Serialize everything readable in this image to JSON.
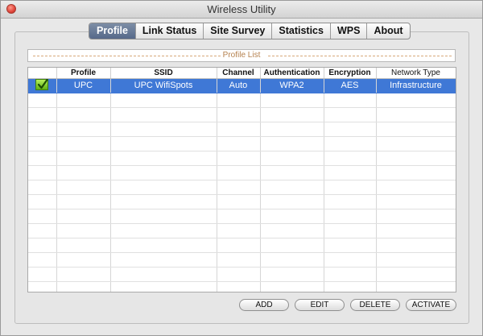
{
  "window": {
    "title": "Wireless Utility"
  },
  "tabs": [
    "Profile",
    "Link Status",
    "Site Survey",
    "Statistics",
    "WPS",
    "About"
  ],
  "active_tab": "Profile",
  "profile_list": {
    "label": "Profile List"
  },
  "table": {
    "columns": [
      "",
      "Profile",
      "SSID",
      "Channel",
      "Authentication",
      "Encryption",
      "Network Type"
    ],
    "rows": [
      {
        "active": true,
        "cells": [
          "UPC",
          "UPC WifiSpots",
          "Auto",
          "WPA2",
          "AES",
          "Infrastructure"
        ]
      }
    ]
  },
  "buttons": {
    "add": "ADD",
    "edit": "EDIT",
    "delete": "DELETE",
    "activate": "ACTIVATE"
  },
  "colors": {
    "selection": "#3f78d6",
    "active_tab": "#5a6d8e",
    "check": "#6cc21f"
  },
  "icons": {
    "active_profile": "checkmark-icon",
    "close": "close-icon"
  }
}
